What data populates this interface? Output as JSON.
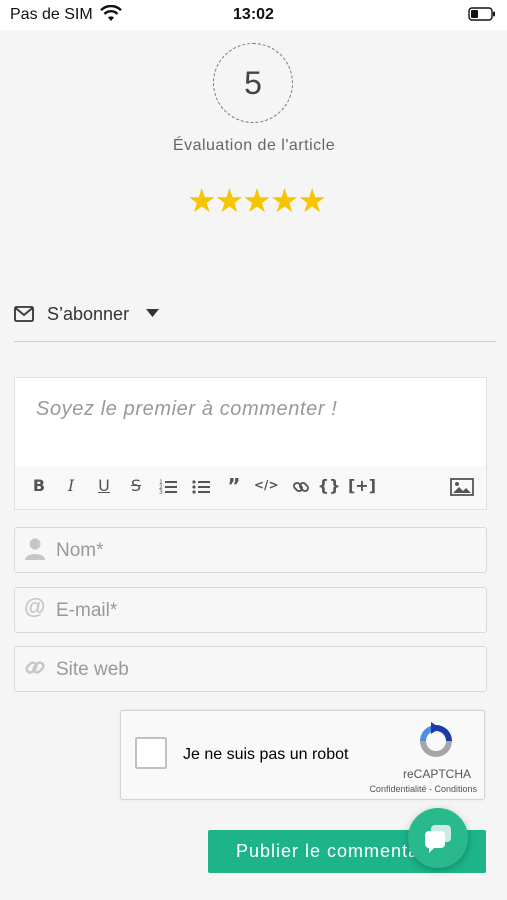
{
  "status_bar": {
    "carrier": "Pas de SIM",
    "time": "13:02"
  },
  "rating": {
    "value": "5",
    "label": "Évaluation de l'article",
    "stars": "★★★★★",
    "star_color": "#f7c500"
  },
  "subscribe": {
    "label": "S’abonner"
  },
  "comment_editor": {
    "placeholder": "Soyez le premier à commenter !",
    "toolbar": [
      "bold-icon",
      "italic-icon",
      "underline-icon",
      "strikethrough-icon",
      "ordered-list-icon",
      "unordered-list-icon",
      "quote-icon",
      "code-icon",
      "link-icon",
      "code-block-icon",
      "spoiler-icon",
      "image-icon"
    ],
    "toolbar_glyphs": {
      "braces": "{}",
      "plus": "[+]"
    }
  },
  "form": {
    "name_placeholder": "Nom*",
    "email_placeholder": "E-mail*",
    "website_placeholder": "Site web"
  },
  "captcha": {
    "label": "Je ne suis pas un robot",
    "brand": "reCAPTCHA",
    "links": "Confidentialité - Conditions"
  },
  "submit": {
    "label": "Publier le commentaire"
  },
  "colors": {
    "accent": "#1db48a",
    "chat": "#28b98c"
  }
}
